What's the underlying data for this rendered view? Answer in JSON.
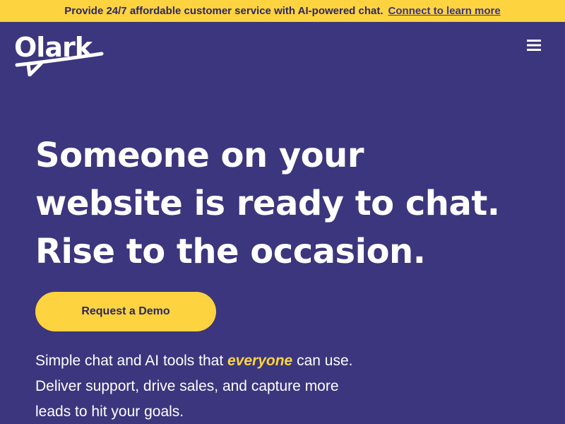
{
  "banner": {
    "text": "Provide 24/7 affordable customer service with AI-powered chat.",
    "link": "Connect to learn more"
  },
  "header": {
    "logo_text": "Olark",
    "menu_icon": "hamburger-menu-icon"
  },
  "hero": {
    "headline_lines": [
      "Someone on your",
      "website is ready to chat.",
      "Rise to the occasion."
    ],
    "cta_label": "Request a Demo",
    "sub_line1_before": "Simple chat and AI tools that ",
    "sub_line1_emphasis": "everyone",
    "sub_line1_after": " can use.",
    "sub_line2": "Deliver support, drive sales, and capture more",
    "sub_line3": "leads to hit your goals."
  },
  "colors": {
    "background": "#3b367d",
    "accent_yellow": "#fdd33f",
    "text_dark": "#2c2860",
    "text_light": "#ffffff"
  }
}
